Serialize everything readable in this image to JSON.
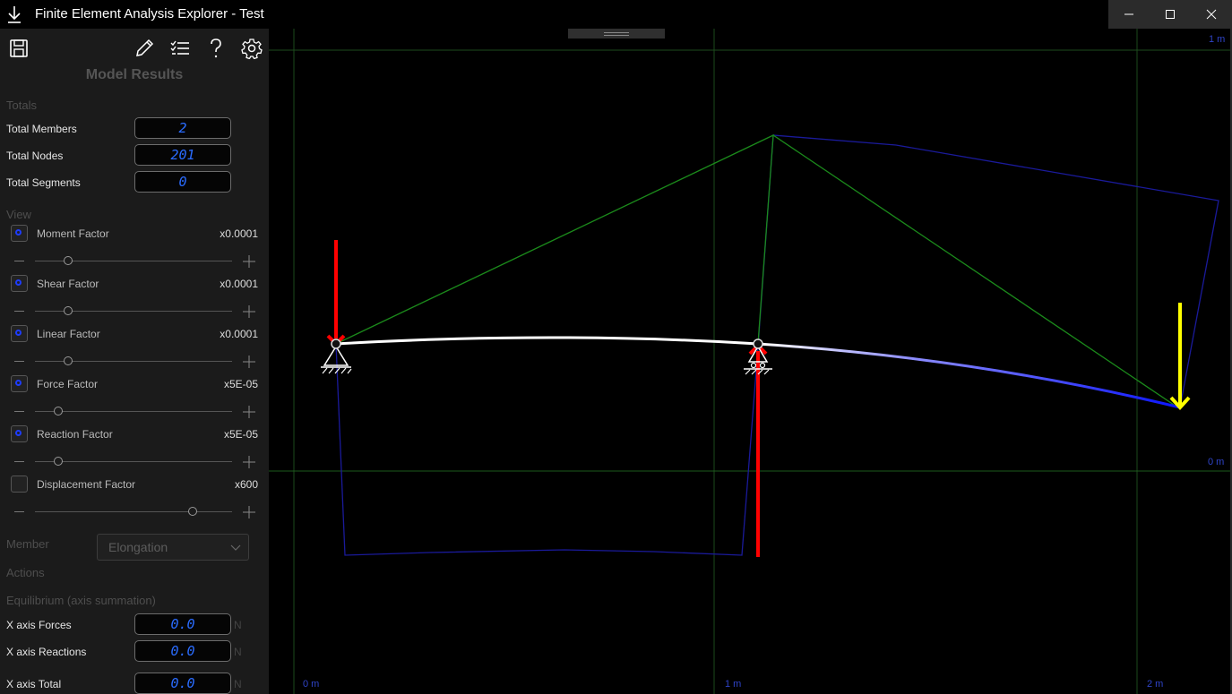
{
  "window": {
    "title": "Finite Element Analysis Explorer - Test",
    "buttons": [
      "minimize",
      "maximize",
      "close"
    ]
  },
  "toolbar": {
    "icons": [
      "save-icon",
      "pencil-icon",
      "checklist-icon",
      "help-icon",
      "gear-icon"
    ]
  },
  "panel": {
    "title": "Model Results",
    "totals": {
      "heading": "Totals",
      "members_label": "Total Members",
      "members_value": "2",
      "nodes_label": "Total Nodes",
      "nodes_value": "201",
      "segments_label": "Total Segments",
      "segments_value": "0"
    },
    "view": {
      "heading": "View",
      "factors": [
        {
          "label": "Moment Factor",
          "value": "x0.0001",
          "checked": true,
          "slider_level": 0.17
        },
        {
          "label": "Shear Factor",
          "value": "x0.0001",
          "checked": true,
          "slider_level": 0.17
        },
        {
          "label": "Linear Factor",
          "value": "x0.0001",
          "checked": true,
          "slider_level": 0.17
        },
        {
          "label": "Force Factor",
          "value": "x5E-05",
          "checked": true,
          "slider_level": 0.12
        },
        {
          "label": "Reaction Factor",
          "value": "x5E-05",
          "checked": true,
          "slider_level": 0.12
        },
        {
          "label": "Displacement Factor",
          "value": "x600",
          "checked": false,
          "slider_level": 0.8
        }
      ]
    },
    "member": {
      "heading": "Member",
      "dropdown_value": "Elongation"
    },
    "actions": {
      "heading": "Actions"
    },
    "equilibrium": {
      "heading": "Equilibrium (axis summation)",
      "x_forces_label": "X axis Forces",
      "x_forces_value": "0.0",
      "x_reactions_label": "X axis Reactions",
      "x_reactions_value": "0.0",
      "x_total_label": "X axis Total",
      "x_total_value": "0.0",
      "unit": "N"
    }
  },
  "canvas": {
    "axis_labels": {
      "x0": "0 m",
      "x1": "1 m",
      "x2": "2 m",
      "y0": "0 m",
      "y1": "1 m"
    },
    "colors": {
      "grid": "#1d5a1d",
      "moment": "#1b8a1b",
      "shear": "#1a1a9a",
      "beam": "#ffffff",
      "beam_end": "#0a14ff",
      "reaction": "#ff0000",
      "force": "#ffff00"
    }
  }
}
